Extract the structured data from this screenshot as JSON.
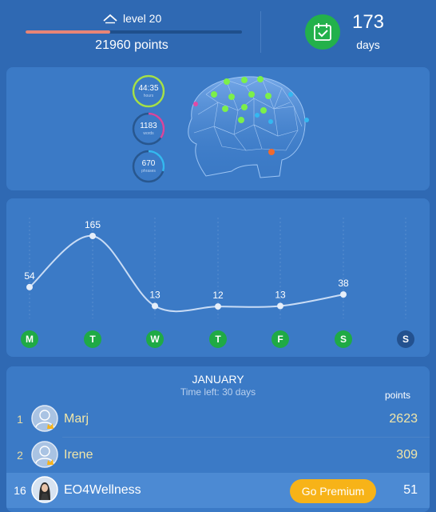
{
  "header": {
    "level_label": "level 20",
    "level_progress": 0.39,
    "points_label": "21960 points",
    "days_count": "173",
    "days_label": "days",
    "colors": {
      "progress_fill": "#e88576",
      "progress_track": "#1f4f8c",
      "calendar_button": "#23b14b"
    }
  },
  "brain_stats": [
    {
      "value": "44:35",
      "unit": "hours",
      "color": "#a4e04a",
      "fraction": 1.0
    },
    {
      "value": "1183",
      "unit": "words",
      "color": "#d8479e",
      "fraction": 0.35
    },
    {
      "value": "670",
      "unit": "phrases",
      "color": "#34b8f0",
      "fraction": 0.3
    }
  ],
  "chart_data": {
    "type": "line",
    "categories": [
      "M",
      "T",
      "W",
      "T",
      "F",
      "S",
      "S"
    ],
    "values": [
      54,
      165,
      13,
      12,
      13,
      38,
      null
    ],
    "labels": [
      "54",
      "165",
      "13",
      "12",
      "13",
      "38",
      ""
    ],
    "active_days": [
      true,
      true,
      true,
      true,
      true,
      true,
      false
    ],
    "ylim": [
      0,
      165
    ],
    "grid": true
  },
  "leaderboard": {
    "month": "JANUARY",
    "time_left": "Time left: 30 days",
    "points_header": "points",
    "rows": [
      {
        "rank": "1",
        "name": "Marj",
        "score": "2623"
      },
      {
        "rank": "2",
        "name": "Irene",
        "score": "309"
      }
    ],
    "me": {
      "rank": "16",
      "name": "EO4Wellness",
      "score": "51",
      "premium_label": "Go Premium"
    }
  }
}
